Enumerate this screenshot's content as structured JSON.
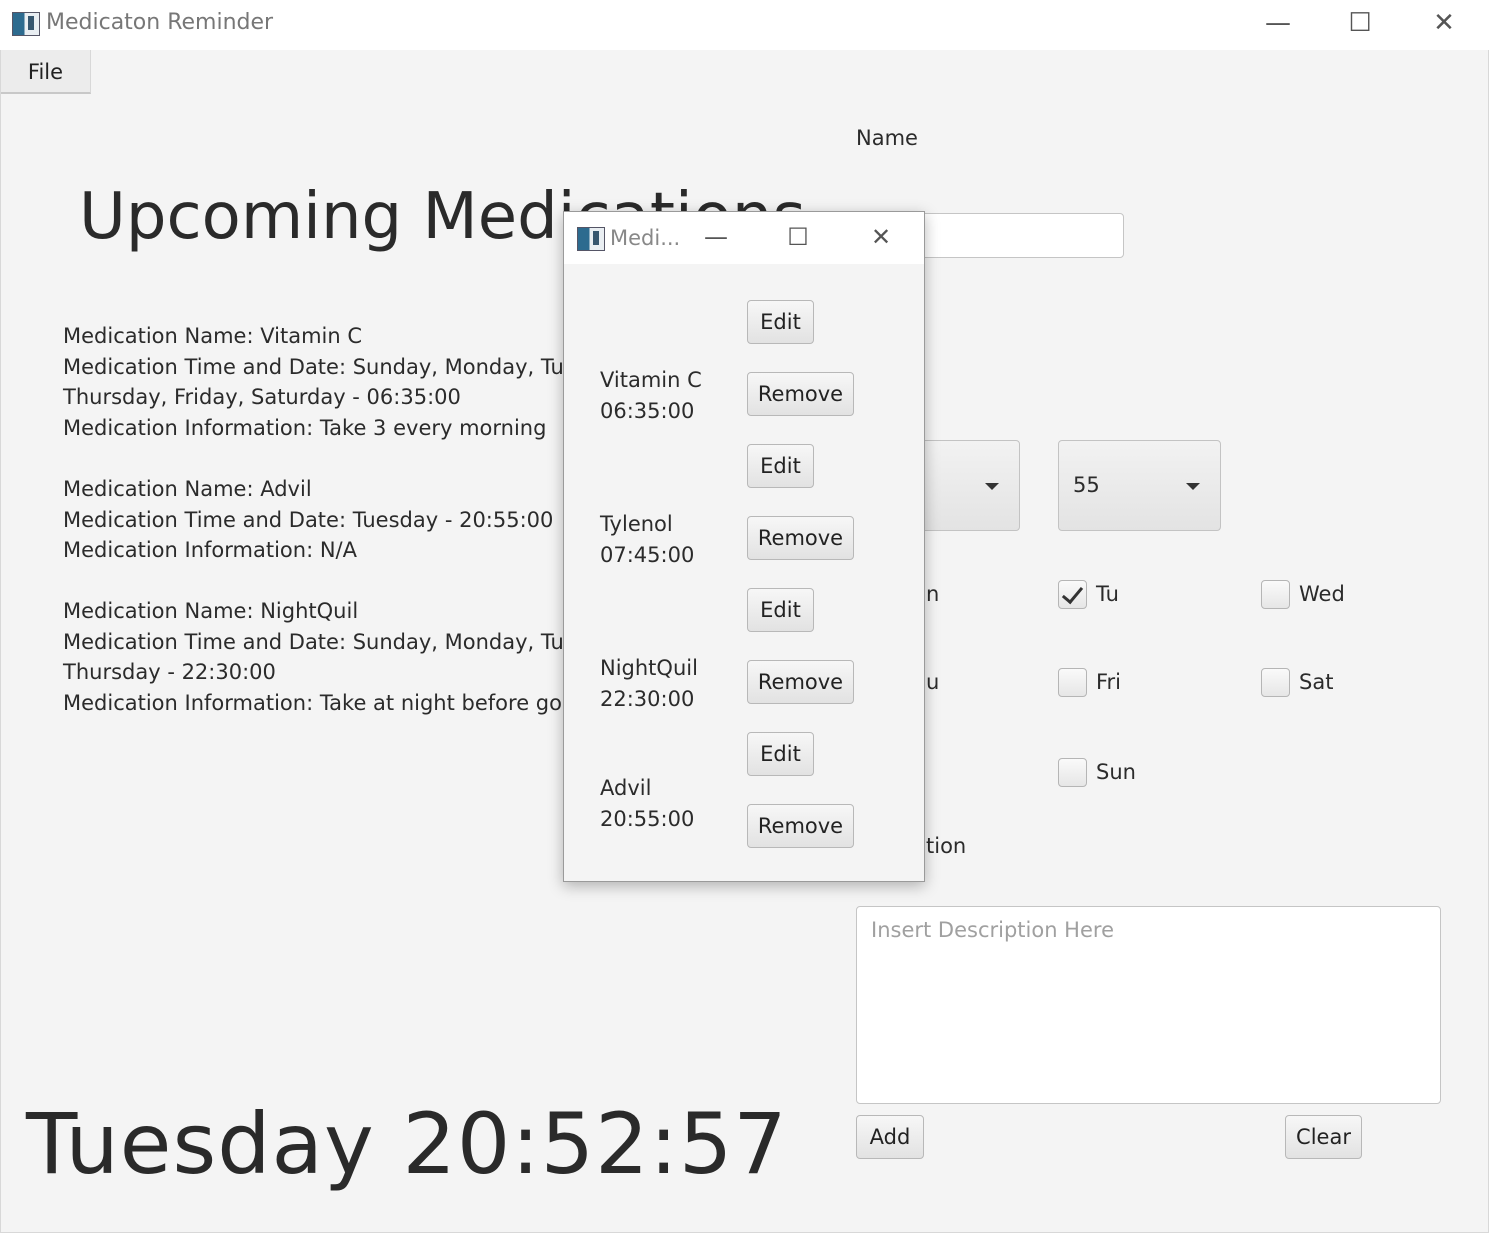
{
  "window": {
    "title": "Medicaton Reminder",
    "minimize_glyph": "—",
    "maximize_glyph": "☐",
    "close_glyph": "✕",
    "icon": "app-window-icon"
  },
  "menu": {
    "file_label": "File"
  },
  "left": {
    "heading": "Upcoming Medications",
    "medications": [
      {
        "line1": "Medication Name: Vitamin C",
        "line2": "Medication Time and Date: Sunday, Monday, Tuesday, Wednesday,",
        "line3": "Thursday, Friday, Saturday - 06:35:00",
        "line4": "Medication Information: Take 3 every morning"
      },
      {
        "line1": "Medication Name: Advil",
        "line2": "Medication Time and Date: Tuesday - 20:55:00",
        "line3": "Medication Information: N/A"
      },
      {
        "line1": "Medication Name: NightQuil",
        "line2": "Medication Time and Date: Sunday, Monday, Tuesday, Wednesday,",
        "line3": "Thursday - 22:30:00",
        "line4": "Medication Information: Take at night before going to bed"
      }
    ],
    "clock": "Tuesday 20:52:57"
  },
  "form": {
    "name_label": "Name",
    "name_value": "",
    "minute_value": "55",
    "days": {
      "mon_fragment": "n",
      "tu": "Tu",
      "wed": "Wed",
      "thu_fragment": "u",
      "fri": "Fri",
      "sat": "Sat",
      "sun": "Sun"
    },
    "checked": {
      "tu": true,
      "wed": false,
      "fri": false,
      "sat": false,
      "sun": false
    },
    "description_label_fragment": "tion",
    "description_placeholder": "Insert Description Here",
    "add_label": "Add",
    "clear_label": "Clear"
  },
  "dialog": {
    "title": "Medi...",
    "edit_label": "Edit",
    "remove_label": "Remove",
    "entries": [
      {
        "name": "Vitamin C",
        "time": "06:35:00"
      },
      {
        "name": "Tylenol",
        "time": "07:45:00"
      },
      {
        "name": "NightQuil",
        "time": "22:30:00"
      },
      {
        "name": "Advil",
        "time": "20:55:00"
      }
    ]
  }
}
